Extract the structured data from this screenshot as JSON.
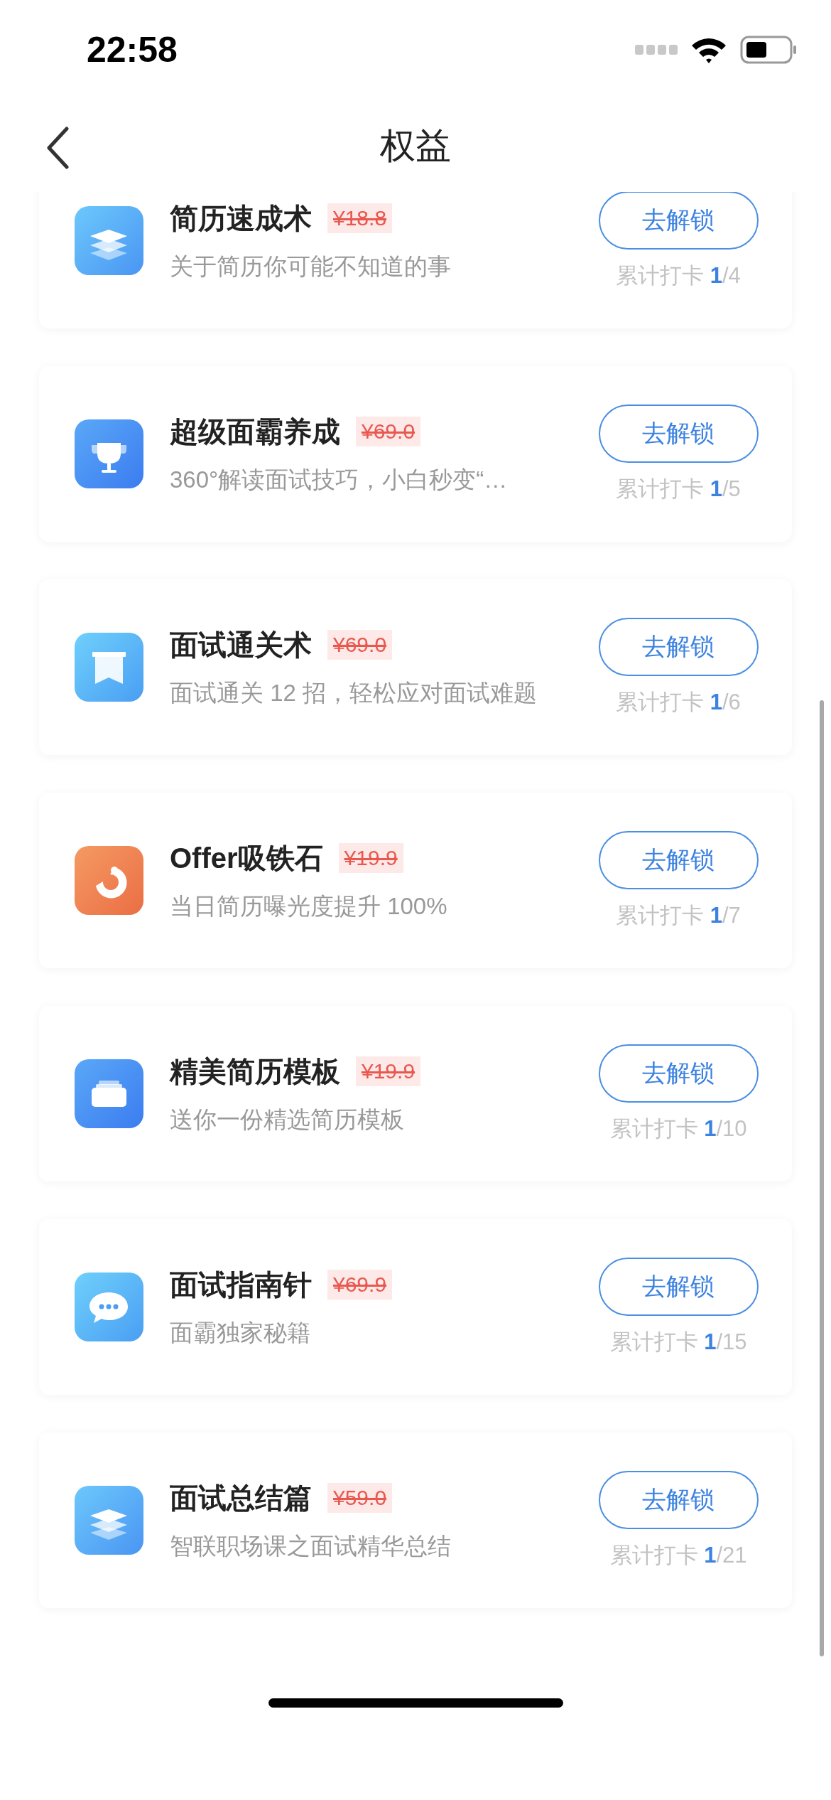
{
  "status_bar": {
    "time": "22:58"
  },
  "nav": {
    "title": "权益"
  },
  "items": [
    {
      "kind": "layers",
      "title": "简历速成术",
      "price": "¥18.8",
      "subtitle": "关于简历你可能不知道的事",
      "button": "去解锁",
      "progress": "累计打卡 **1**/4"
    },
    {
      "kind": "trophy",
      "title": "超级面霸养成",
      "price": "¥69.0",
      "subtitle": "360°解读面试技巧，小白秒变“…",
      "button": "去解锁",
      "progress": "累计打卡 **1**/5"
    },
    {
      "kind": "bookmark",
      "title": "面试通关术",
      "price": "¥69.0",
      "subtitle": "面试通关 12 招，轻松应对面试难题",
      "button": "去解锁",
      "progress": "累计打卡 **1**/6"
    },
    {
      "kind": "magnet",
      "title": "Offer吸铁石",
      "price": "¥19.9",
      "subtitle": "当日简历曝光度提升 100%",
      "button": "去解锁",
      "progress": "累计打卡 **1**/7"
    },
    {
      "kind": "tray",
      "title": "精美简历模板",
      "price": "¥19.9",
      "subtitle": "送你一份精选简历模板",
      "button": "去解锁",
      "progress": "累计打卡 **1**/10"
    },
    {
      "kind": "chat",
      "title": "面试指南针",
      "price": "¥69.9",
      "subtitle": "面霸独家秘籍",
      "button": "去解锁",
      "progress": "累计打卡 **1**/15"
    },
    {
      "kind": "layers",
      "title": "面试总结篇",
      "price": "¥59.0",
      "subtitle": "智联职场课之面试精华总结",
      "button": "去解锁",
      "progress": "累计打卡 **1**/21"
    }
  ]
}
